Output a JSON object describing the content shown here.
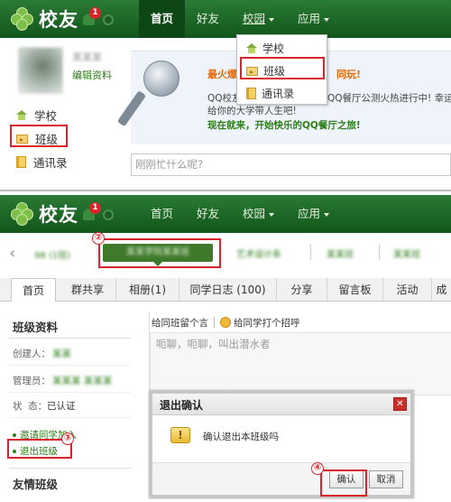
{
  "panel1": {
    "logo": "校友",
    "badge": "1",
    "nav": [
      "首页",
      "好友",
      "校园",
      "应用"
    ],
    "dropdown": [
      "学校",
      "班级",
      "通讯录"
    ],
    "user_name": "某某某",
    "edit_profile": "编辑资料",
    "side": [
      "学校",
      "班级",
      "通讯录"
    ],
    "banner_title1": "最火爆",
    "banner_title2": "同玩!",
    "banner_body1": "QQ校友",
    "banner_body2": "QQ餐厅公测火热进行中! 幸运",
    "banner_body3": "给你的大学带人生吧!",
    "banner_cta": "现在就来，开始快乐的QQ餐厅之旅!",
    "status_placeholder": "刚刚忙什么呢?"
  },
  "panel2": {
    "logo": "校友",
    "badge": "1",
    "nav": [
      "首页",
      "好友",
      "校园",
      "应用"
    ],
    "breadcrumb_prev": "98 (1班)",
    "breadcrumb_active": "某某学院某某班",
    "breadcrumb_items": [
      "艺术设计系",
      "某某班",
      "某某班"
    ],
    "circle2": "②",
    "tabs": [
      "首页",
      "群共享",
      "相册(1)",
      "同学日志 (100)",
      "分享",
      "留言板",
      "活动",
      "成"
    ],
    "sidebar_title": "班级资料",
    "creator_label": "创建人：",
    "creator_value": "某某",
    "admin_label": "管理员：",
    "admin_value": "某某某 某某某",
    "status_label": "状  态：",
    "status_value": "已认证",
    "invite": "邀请同学加入",
    "quit": "退出班级",
    "circle3": "③",
    "friend_title": "友情班级",
    "msg_tab1": "给同班留个言",
    "msg_tab2": "给同学打个招呼",
    "msg_placeholder": "呃聊，呃聊，叫出潜水者",
    "dialog_title": "退出确认",
    "dialog_msg": "确认退出本班级吗",
    "dialog_ok": "确认",
    "dialog_cancel": "取消",
    "circle4": "④",
    "dialog_close": "✕"
  },
  "colors": {
    "nav_green": "#1c6a27",
    "accent_red": "#d8232a",
    "link_green": "#2d7f1a"
  }
}
